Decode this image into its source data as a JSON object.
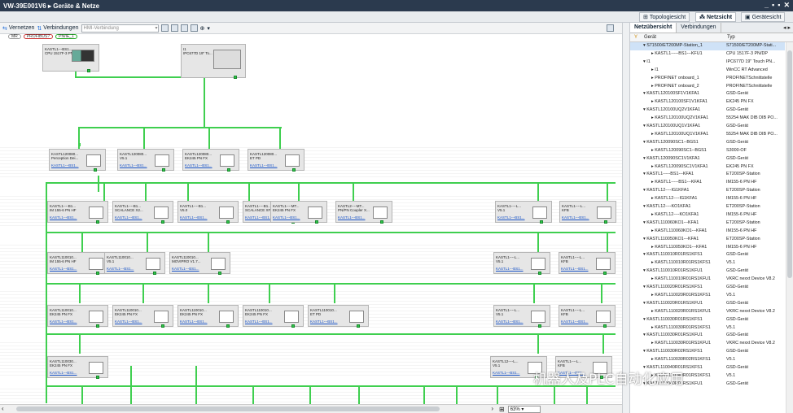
{
  "title": "VW-39E001V6 ▸ Geräte & Netze",
  "window_controls": [
    "_",
    "▪",
    "▪",
    "✕"
  ],
  "view_tabs": [
    "Topologiesicht",
    "Netzsicht",
    "Gerätesicht"
  ],
  "toolbar": {
    "network": "Vernetzen",
    "connections": "Verbindungen",
    "hmi_connection": "HMI-Verbindung"
  },
  "legend": [
    "MR",
    "PROFIBUS?",
    "PN/IE_1"
  ],
  "zoom": "63%",
  "right_tabs": [
    "Netzübersicht",
    "Verbindungen"
  ],
  "table_header": {
    "device": "Gerät",
    "type": "Typ"
  },
  "rows": [
    {
      "d": "S71500/ET200MP-Station_1",
      "t": "S71500/ET200MP-Stati...",
      "lvl": 0,
      "sel": true
    },
    {
      "d": "KASTL1-----BS1---KFU1",
      "t": "CPU 1517F-3 PN/DP",
      "lvl": 1
    },
    {
      "d": "I1",
      "t": "IPC677D 19\" Touch PN...",
      "lvl": 0
    },
    {
      "d": "I1",
      "t": "WinCC RT Advanced",
      "lvl": 1
    },
    {
      "d": "PROFINET onboard_1",
      "t": "PROFINETSchnittstelle",
      "lvl": 1
    },
    {
      "d": "PROFINET onboard_2",
      "t": "PROFINETSchnittstelle",
      "lvl": 1
    },
    {
      "d": "KASTL120100SF1V1KFA1",
      "t": "GSD-Gerät",
      "lvl": 0
    },
    {
      "d": "KASTL120100SF1V1KFA1",
      "t": "EK245 PN FX",
      "lvl": 1
    },
    {
      "d": "KASTL120100UQ2V1KFA1",
      "t": "GSD-Gerät",
      "lvl": 0
    },
    {
      "d": "KASTL120100UQ2V1KFA1",
      "t": "55254 MAK DIB DIB PO...",
      "lvl": 1
    },
    {
      "d": "KASTL120100UQ1V1KFA1",
      "t": "GSD-Gerät",
      "lvl": 0
    },
    {
      "d": "KASTL120100UQ1V1KFA1",
      "t": "55254 MAK DIB DIB PO...",
      "lvl": 1
    },
    {
      "d": "KASTL120090SC1--BGS1",
      "t": "GSD-Gerät",
      "lvl": 0
    },
    {
      "d": "KASTL120090SC1--BGS1",
      "t": "S3000-OF",
      "lvl": 1
    },
    {
      "d": "KASTL120090SC1V1KFA1",
      "t": "GSD-Gerät",
      "lvl": 0
    },
    {
      "d": "KASTL120090SC1V1KFA1",
      "t": "EK245 PN FX",
      "lvl": 1
    },
    {
      "d": "KASTL1-----BS1---KFA1",
      "t": "ET200SP-Station",
      "lvl": 0
    },
    {
      "d": "KASTL1-----BS1---KFA1",
      "t": "IM155-6 PN HF",
      "lvl": 1
    },
    {
      "d": "KASTL12----IG1KFA1",
      "t": "ET200SP-Station",
      "lvl": 0
    },
    {
      "d": "KASTL12----IG1KFA1",
      "t": "IM155-6 PN HF",
      "lvl": 1
    },
    {
      "d": "KASTL12----KO1KFA1",
      "t": "ET200SP-Station",
      "lvl": 0
    },
    {
      "d": "KASTL12----KO1KFA1",
      "t": "IM155-6 PN HF",
      "lvl": 1
    },
    {
      "d": "KASTL110060KO1---KFA1",
      "t": "ET200SP-Station",
      "lvl": 0
    },
    {
      "d": "KASTL110060KO1---KFA1",
      "t": "IM155-6 PN HF",
      "lvl": 1
    },
    {
      "d": "KASTL110050KO1---KFA1",
      "t": "ET200SP-Station",
      "lvl": 0
    },
    {
      "d": "KASTL110050KO1---KFA1",
      "t": "IM155-6 PN HF",
      "lvl": 1
    },
    {
      "d": "KASTL110010R01RS1KFS1",
      "t": "GSD-Gerät",
      "lvl": 0
    },
    {
      "d": "KASTL110010R01RS1KFS1",
      "t": "V5.1",
      "lvl": 1
    },
    {
      "d": "KASTL110010R01RS1KFU1",
      "t": "GSD-Gerät",
      "lvl": 0
    },
    {
      "d": "KASTL110010R01RS1KFU1",
      "t": "VKRC nexxt Device V8.2",
      "lvl": 1
    },
    {
      "d": "KASTL110020R01RS1KFS1",
      "t": "GSD-Gerät",
      "lvl": 0
    },
    {
      "d": "KASTL110020R01RS1KFS1",
      "t": "V5.1",
      "lvl": 1
    },
    {
      "d": "KASTL110020R01RS1KFU1",
      "t": "GSD-Gerät",
      "lvl": 0
    },
    {
      "d": "KASTL110020R01RS1KFU1",
      "t": "VKRC nexxt Device V8.2",
      "lvl": 1
    },
    {
      "d": "KASTL110030R01RS1KFS1",
      "t": "GSD-Gerät",
      "lvl": 0
    },
    {
      "d": "KASTL110030R01RS1KFS1",
      "t": "V5.1",
      "lvl": 1
    },
    {
      "d": "KASTL110030R01RS1KFU1",
      "t": "GSD-Gerät",
      "lvl": 0
    },
    {
      "d": "KASTL110030R01RS1KFU1",
      "t": "VKRC nexxt Device V8.2",
      "lvl": 1
    },
    {
      "d": "KASTL110030R02RS1KFS1",
      "t": "GSD-Gerät",
      "lvl": 0
    },
    {
      "d": "KASTL110030R02RS1KFS1",
      "t": "V5.1",
      "lvl": 1
    },
    {
      "d": "KASTL110040R01RS1KFS1",
      "t": "GSD-Gerät",
      "lvl": 0
    },
    {
      "d": "KASTL110040R01RS1KFS1",
      "t": "V5.1",
      "lvl": 1
    },
    {
      "d": "KASTL110040R01RS1KFU1",
      "t": "GSD-Gerät",
      "lvl": 0
    }
  ],
  "devices": [
    {
      "n1": "KASTL1---BS1...",
      "n2": "CPU 1517F-3 PN/...",
      "link": ""
    },
    {
      "n1": "I1",
      "n2": "IPC677D 19\" To...",
      "link": ""
    },
    {
      "n1": "KASTL120080...",
      "n2": "Perception Dei...",
      "link": "KASTL1---BS1..."
    },
    {
      "n1": "KASTL120080...",
      "n2": "V5.1",
      "link": "KASTL1---BS1..."
    },
    {
      "n1": "KASTL120080...",
      "n2": "EK245 PN FX",
      "link": "KASTL1---BS1..."
    },
    {
      "n1": "KASTL120080...",
      "n2": "ET PD",
      "link": "KASTL1---BS1..."
    },
    {
      "n1": "KASTL1----B1...",
      "n2": "IM 155-6 PN HF",
      "link": "KASTL1---BS1..."
    },
    {
      "n1": "KASTL1----B1...",
      "n2": "SCALANCE X2...",
      "link": "KASTL1---BS1..."
    },
    {
      "n1": "KASTL1----B1...",
      "n2": "V5.0",
      "link": "KASTL1---BS1..."
    },
    {
      "n1": "KASTL1----B1...",
      "n2": "SCALANCE XF208",
      "link": "KASTL1---BS1..."
    },
    {
      "n1": "KASTL1----MT...",
      "n2": "EK245 PN FX",
      "link": "KASTL1---BS1..."
    },
    {
      "n1": "KASTL2----MT...",
      "n2": "PN/PN Coupler X...",
      "link": "KASTL1---BS1..."
    },
    {
      "n1": "KASTL1----L...",
      "n2": "V5.1",
      "link": "KASTL1---BS1..."
    },
    {
      "n1": "KASTL1----L...",
      "n2": "KFB",
      "link": "KASTL1---BS1..."
    },
    {
      "n1": "KASTL110010...",
      "n2": "IM 155-6 PN HF",
      "link": "KASTL1---BS1..."
    },
    {
      "n1": "KASTL110010...",
      "n2": "V5.1",
      "link": "KASTL1---BS1..."
    },
    {
      "n1": "KASTL110010...",
      "n2": "MOVIPRO V1.7...",
      "link": "KASTL1---BS1..."
    },
    {
      "n1": "KASTL1----L...",
      "n2": "V5.1",
      "link": "KASTL1---BS1..."
    },
    {
      "n1": "KASTL1----L...",
      "n2": "KFB",
      "link": "KASTL1---BS1..."
    },
    {
      "n1": "KASTL110010...",
      "n2": "EK245 PN FX",
      "link": "KASTL1---BS1..."
    },
    {
      "n1": "KASTL110010...",
      "n2": "EK245 PN FX",
      "link": "KASTL1---BS1..."
    },
    {
      "n1": "KASTL110010...",
      "n2": "EK245 PN FX",
      "link": "KASTL1---BS1..."
    },
    {
      "n1": "KASTL110010...",
      "n2": "EK245 PN FX",
      "link": "KASTL1---BS1..."
    },
    {
      "n1": "KASTL110010...",
      "n2": "ET PD",
      "link": "KASTL1---BS1..."
    },
    {
      "n1": "KASTL1----L...",
      "n2": "V5.1",
      "link": "KASTL1---BS1..."
    },
    {
      "n1": "KASTL1----L...",
      "n2": "KFB",
      "link": "KASTL1---BS1..."
    },
    {
      "n1": "KASTL110030...",
      "n2": "EK245 PN FX",
      "link": "KASTL1---BS1..."
    },
    {
      "n1": "KASTL12----L...",
      "n2": "V5.1",
      "link": "KASTL1---BS1..."
    },
    {
      "n1": "KASTL1----L...",
      "n2": "KFB",
      "link": "KASTL1---BS1..."
    }
  ],
  "watermark": "机器人及PLC自动化应用",
  "colors": {
    "network_line": "#3fcf4f",
    "title_bg": "#2b3a4e"
  }
}
